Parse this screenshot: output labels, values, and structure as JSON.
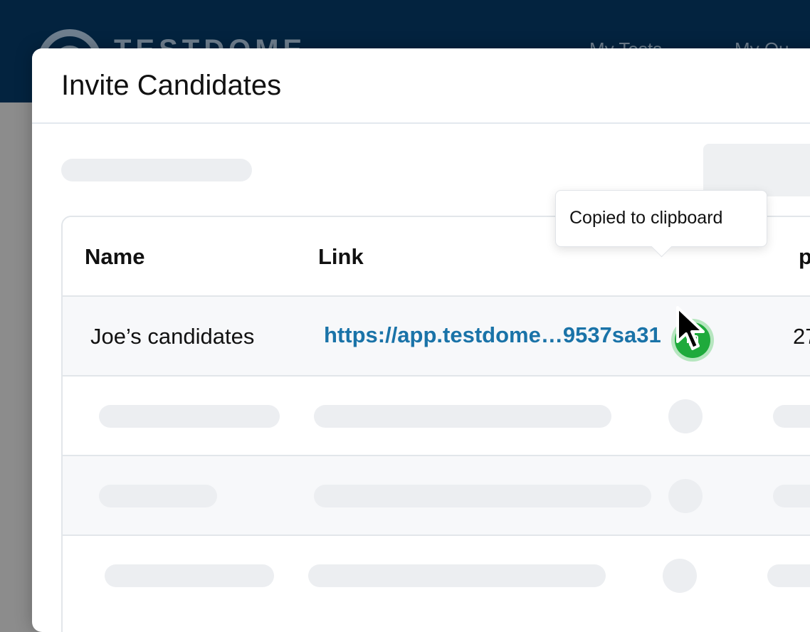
{
  "background": {
    "logo_text": "TESTDOME",
    "nav_items": [
      "My Tests",
      "My Qu"
    ]
  },
  "modal": {
    "title": "Invite Candidates"
  },
  "table": {
    "columns": [
      "Name",
      "Link",
      "p"
    ],
    "rows": [
      {
        "name": "Joe’s candidates",
        "link": "https://app.testdome…9537sa31",
        "extra": "27"
      }
    ]
  },
  "tooltip": {
    "text": "Copied to clipboard"
  },
  "icons": {
    "copy": "copy-icon",
    "cursor": "mouse-pointer-icon"
  },
  "colors": {
    "header_bg": "#03233f",
    "link": "#1a73a8",
    "copy_button": "#1faa3c"
  }
}
